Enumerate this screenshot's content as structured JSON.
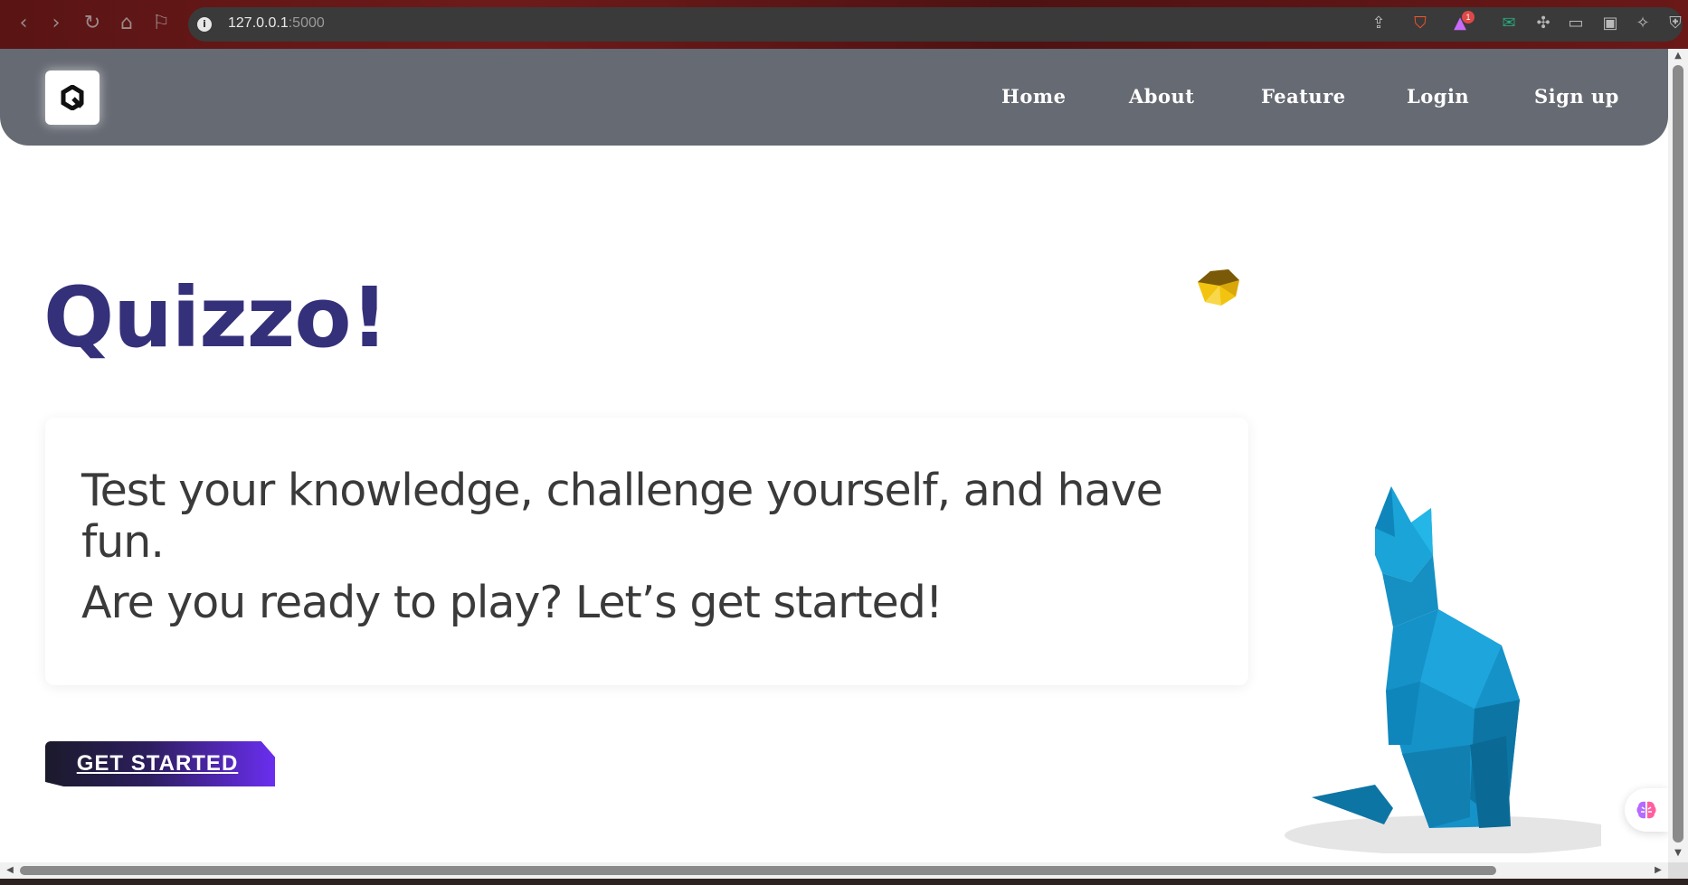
{
  "browser": {
    "url_host": "127.0.0.1",
    "url_port": ":5000",
    "extension_badge": "1",
    "icons": [
      "back-icon",
      "forward-icon",
      "reload-icon",
      "home-icon",
      "bookmark-icon",
      "info-icon",
      "share-icon",
      "brave-shield-icon",
      "brave-rewards-icon",
      "mail-extension-icon",
      "extensions-icon",
      "sidebar-icon",
      "wallet-icon",
      "leo-ai-icon",
      "vpn-icon"
    ]
  },
  "navbar": {
    "links": [
      "Home",
      "About",
      "Feature",
      "Login",
      "Sign up"
    ]
  },
  "hero": {
    "title": "Quizzo!",
    "line1": "Test your knowledge, challenge yourself, and have fun.",
    "line2": "Are you ready to play? Let’s get started!",
    "cta": "GET STARTED"
  },
  "colors": {
    "navbar": "#666a73",
    "title": "#35307a",
    "cta_start": "#1b1a2b",
    "cta_end": "#6a2ef0",
    "cat": "#1a8fc6",
    "gem": "#f2c40f"
  }
}
